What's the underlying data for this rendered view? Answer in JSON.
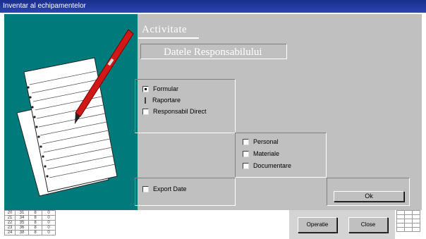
{
  "window": {
    "title": "Inventar al echipamentelor"
  },
  "header": {
    "title": "Activitate",
    "subtitle": "Datele Responsabilului"
  },
  "options_group1": [
    {
      "label": "Formular",
      "style": "checked"
    },
    {
      "label": "Raportare",
      "style": "bar"
    },
    {
      "label": "Responsabil Direct",
      "style": "unchecked"
    }
  ],
  "options_group2": [
    {
      "label": "Personal"
    },
    {
      "label": "Materiale"
    },
    {
      "label": "Documentare"
    }
  ],
  "bottom_option": {
    "label": "Export Date"
  },
  "buttons": {
    "ok": "Ok",
    "sheet_back": "Operatie",
    "sheet_close": "Close"
  },
  "sheet": {
    "rows": [
      [
        "20",
        "31",
        "8",
        "0"
      ],
      [
        "21",
        "34",
        "8",
        "0"
      ],
      [
        "22",
        "35",
        "8",
        "0"
      ],
      [
        "23",
        "36",
        "8",
        "0"
      ],
      [
        "24",
        "38",
        "8",
        "0"
      ]
    ]
  },
  "colors": {
    "teal": "#007a7a",
    "face": "#c0c0c0",
    "titlebar": "#1a2e8c"
  }
}
